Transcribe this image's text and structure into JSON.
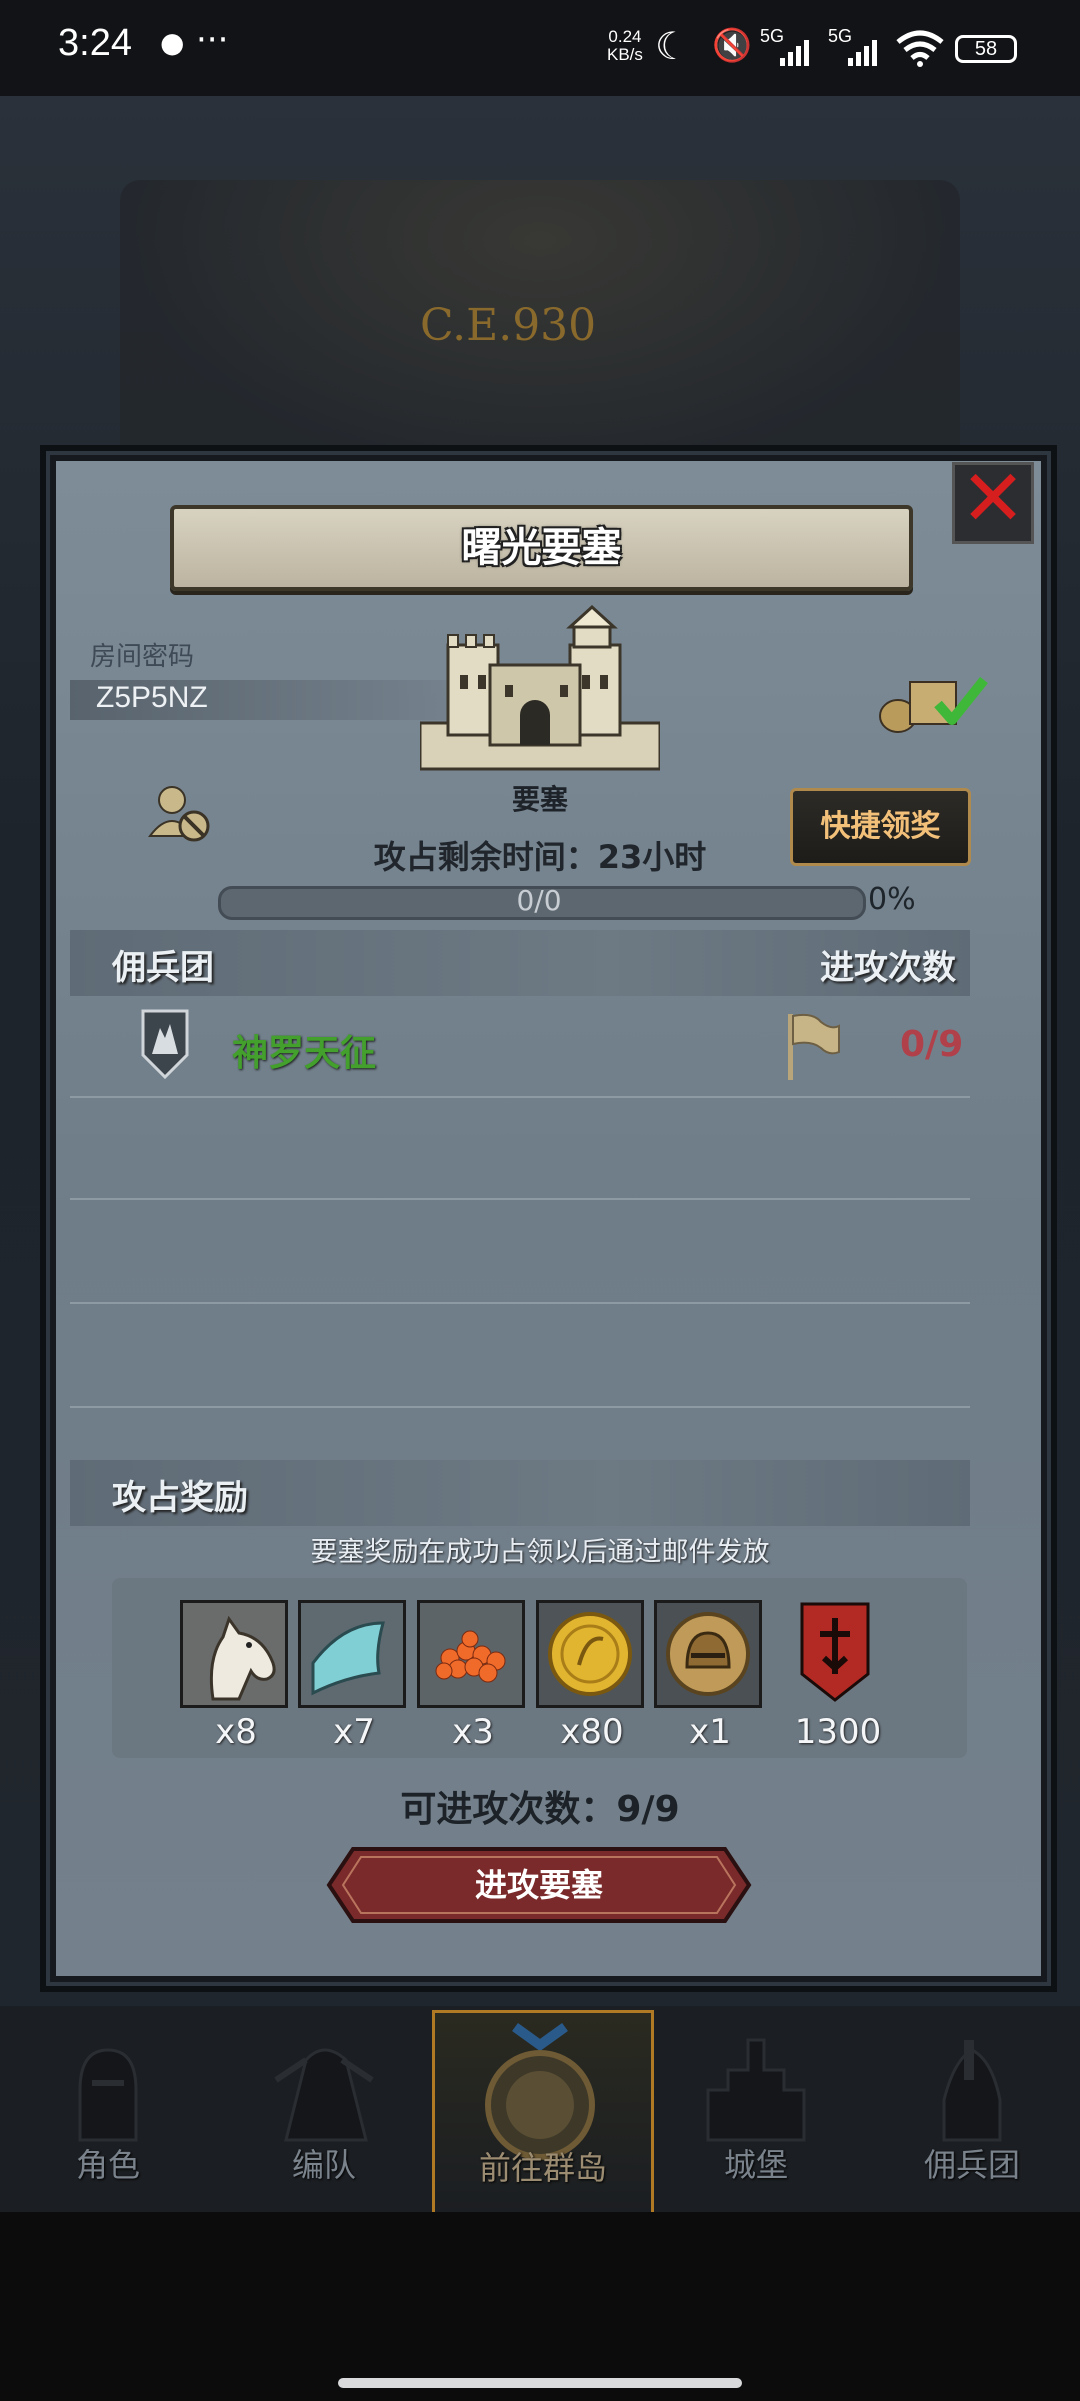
{
  "status_bar": {
    "time": "3:24",
    "more": "···",
    "net_speed_value": "0.24",
    "net_speed_unit": "KB/s",
    "sim1": "5G",
    "sim2": "5G",
    "battery": "58"
  },
  "background": {
    "era": "C.E.930"
  },
  "modal": {
    "title": "曙光要塞",
    "room_code_label": "房间密码",
    "room_code": "Z5P5NZ",
    "fortress_label": "要塞",
    "time_left": "攻占剩余时间：23小时",
    "progress_text": "0/0",
    "progress_fraction": 0,
    "progress_percent": "0%",
    "quick_claim": "快捷领奖",
    "mercenary_section": "佣兵团",
    "attack_count_header": "进攻次数",
    "guilds": [
      {
        "name": "神罗天征",
        "attacks": "0/9"
      }
    ],
    "reward_section": "攻占奖励",
    "reward_note": "要塞奖励在成功占领以后通过邮件发放",
    "rewards": [
      {
        "icon": "horse-icon",
        "qty": "x8"
      },
      {
        "icon": "cloth-icon",
        "qty": "x7"
      },
      {
        "icon": "caviar-icon",
        "qty": "x3"
      },
      {
        "icon": "gold-coin-icon",
        "qty": "x80"
      },
      {
        "icon": "helmet-coin-icon",
        "qty": "x1"
      },
      {
        "icon": "honor-banner-icon",
        "qty": "1300"
      }
    ],
    "attacks_available": "可进攻次数：9/9",
    "attack_button": "进攻要塞"
  },
  "bottom_nav": [
    {
      "label": "角色"
    },
    {
      "label": "编队"
    },
    {
      "label": "前往群岛",
      "active": true
    },
    {
      "label": "城堡"
    },
    {
      "label": "佣兵团"
    }
  ],
  "colors": {
    "accent_green": "#43a02c",
    "attack_count_red": "#b0404a",
    "button_red": "#7a2a2a",
    "gold_border": "#b08a4c"
  }
}
